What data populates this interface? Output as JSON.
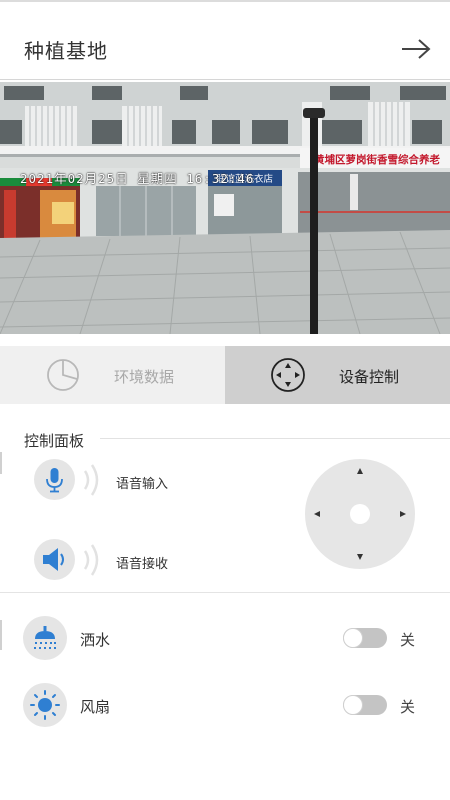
{
  "header": {
    "title": "种植基地",
    "action_icon": "arrow-right-icon"
  },
  "camera": {
    "osd_text": "2021年02月25日 星期四 16:32:46",
    "store_sign_1": "联谊蓝洗衣店",
    "store_sign_2": "黄埔区萝岗街香雪综合养老"
  },
  "tabs": [
    {
      "label": "环境数据",
      "icon": "pie-chart-icon",
      "active": false
    },
    {
      "label": "设备控制",
      "icon": "direction-pad-icon",
      "active": true
    }
  ],
  "panel": {
    "title": "控制面板",
    "voice_input": {
      "label": "语音输入",
      "icon": "microphone-icon"
    },
    "voice_receive": {
      "label": "语音接收",
      "icon": "speaker-icon"
    }
  },
  "devices": [
    {
      "label": "洒水",
      "icon": "sprinkler-icon",
      "state": "关",
      "on": false
    },
    {
      "label": "风扇",
      "icon": "sun-fan-icon",
      "state": "关",
      "on": false
    }
  ],
  "colors": {
    "accent_blue": "#2f7fd2",
    "active_tab": "#cfcfcf",
    "inactive_tab": "#f0f0f0"
  }
}
